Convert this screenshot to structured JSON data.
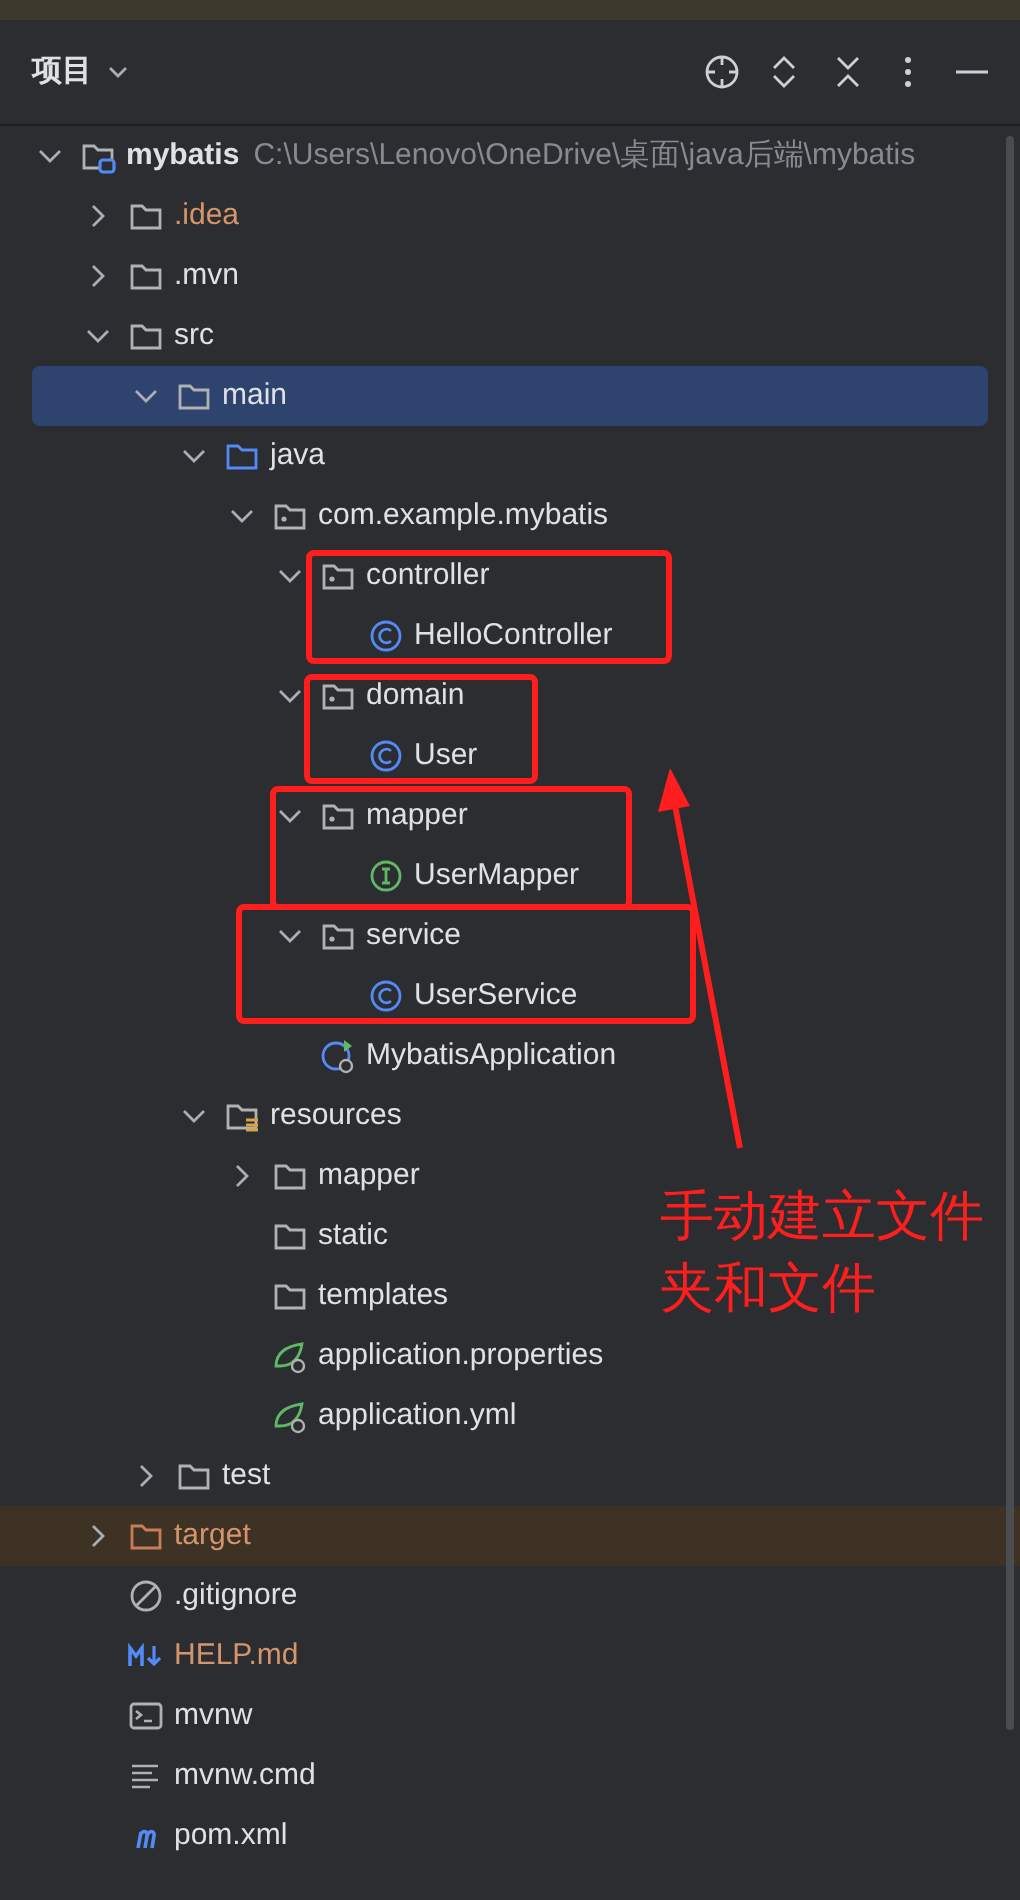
{
  "panel": {
    "title": "项目"
  },
  "tree": [
    {
      "label": "mybatis",
      "path": "C:\\Users\\Lenovo\\OneDrive\\桌面\\java后端\\mybatis",
      "kind": "module",
      "expanded": true,
      "selected": false,
      "children": [
        {
          "label": ".idea",
          "kind": "folder",
          "ignored": true,
          "excluded": false,
          "expanded": false,
          "selected": false
        },
        {
          "label": ".mvn",
          "kind": "folder",
          "ignored": false,
          "excluded": false,
          "expanded": false,
          "selected": false
        },
        {
          "label": "src",
          "kind": "folder",
          "ignored": false,
          "excluded": false,
          "expanded": true,
          "selected": false,
          "children": [
            {
              "label": "main",
              "kind": "folder",
              "expanded": true,
              "selected": true,
              "children": [
                {
                  "label": "java",
                  "kind": "source-folder",
                  "expanded": true,
                  "selected": false,
                  "children": [
                    {
                      "label": "com.example.mybatis",
                      "kind": "package",
                      "expanded": true,
                      "selected": false,
                      "children": [
                        {
                          "label": "controller",
                          "kind": "package",
                          "expanded": true,
                          "selected": false,
                          "children": [
                            {
                              "label": "HelloController",
                              "kind": "class",
                              "selected": false
                            }
                          ]
                        },
                        {
                          "label": "domain",
                          "kind": "package",
                          "expanded": true,
                          "selected": false,
                          "children": [
                            {
                              "label": "User",
                              "kind": "class",
                              "selected": false
                            }
                          ]
                        },
                        {
                          "label": "mapper",
                          "kind": "package",
                          "expanded": true,
                          "selected": false,
                          "children": [
                            {
                              "label": "UserMapper",
                              "kind": "interface",
                              "selected": false
                            }
                          ]
                        },
                        {
                          "label": "service",
                          "kind": "package",
                          "expanded": true,
                          "selected": false,
                          "children": [
                            {
                              "label": "UserService",
                              "kind": "class",
                              "selected": false
                            }
                          ]
                        },
                        {
                          "label": "MybatisApplication",
                          "kind": "spring-app",
                          "selected": false
                        }
                      ]
                    }
                  ]
                },
                {
                  "label": "resources",
                  "kind": "resources-folder",
                  "expanded": true,
                  "selected": false,
                  "children": [
                    {
                      "label": "mapper",
                      "kind": "folder",
                      "expanded": false,
                      "selected": false
                    },
                    {
                      "label": "static",
                      "kind": "folder",
                      "selected": false
                    },
                    {
                      "label": "templates",
                      "kind": "folder",
                      "selected": false
                    },
                    {
                      "label": "application.properties",
                      "kind": "spring-config",
                      "selected": false
                    },
                    {
                      "label": "application.yml",
                      "kind": "spring-config",
                      "selected": false
                    }
                  ]
                }
              ]
            },
            {
              "label": "test",
              "kind": "folder",
              "expanded": false,
              "selected": false
            }
          ]
        },
        {
          "label": "target",
          "kind": "folder",
          "ignored": false,
          "excluded": true,
          "expanded": false,
          "selected": false
        },
        {
          "label": ".gitignore",
          "kind": "gitignore",
          "ignored": false,
          "excluded": false,
          "selected": false
        },
        {
          "label": "HELP.md",
          "kind": "markdown",
          "ignored": true,
          "excluded": false,
          "selected": false
        },
        {
          "label": "mvnw",
          "kind": "shell",
          "ignored": false,
          "excluded": false,
          "selected": false
        },
        {
          "label": "mvnw.cmd",
          "kind": "text",
          "ignored": false,
          "excluded": false,
          "selected": false
        },
        {
          "label": "pom.xml",
          "kind": "maven",
          "ignored": false,
          "excluded": false,
          "selected": false
        }
      ]
    }
  ],
  "annotation": {
    "note": [
      "手动建立文件",
      "夹和文件"
    ]
  }
}
